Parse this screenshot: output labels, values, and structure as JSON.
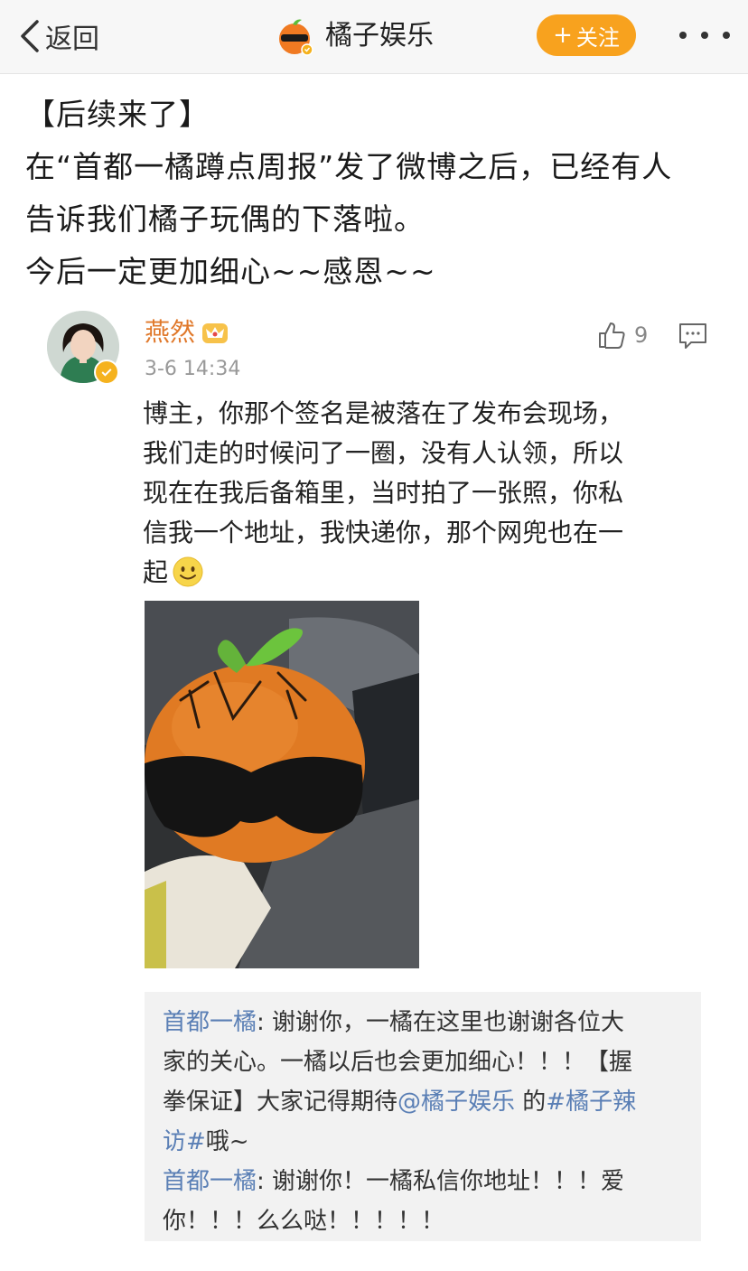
{
  "nav": {
    "back_label": "返回",
    "title": "橘子娱乐",
    "follow_plus": "+",
    "follow_label": "关注",
    "avatar_icon": "sunglasses-orange-logo-icon",
    "more_icon": "more-dots-icon",
    "accent": "#f8a21e"
  },
  "post": {
    "lines": [
      "【后续来了】",
      "在“首都一橘蹲点周报”发了微博之后，已经有人",
      "告诉我们橘子玩偶的下落啦。",
      "今后一定更加细心~~感恩~~"
    ]
  },
  "comment": {
    "user": "燕然",
    "time": "3-6 14:34",
    "likes": "9",
    "text_lines": [
      "博主，你那个签名是被落在了发布会现场，",
      "我们走的时候问了一圈，没有人认领，所以",
      "现在在我后备箱里，当时拍了一张照，你私",
      "信我一个地址，我快递你，那个网兜也在一",
      "起"
    ],
    "name_color": "#e0782a"
  },
  "replies": {
    "r1_user": "首都一橘",
    "r1_l1": ": 谢谢你，一橘在这里也谢谢各位大",
    "r1_l2": "家的关心。一橘以后也会更加细心！！！【握",
    "r1_l3": "拳保证】大家记得期待",
    "r1_mention": "@橘子娱乐",
    "r1_de": " 的",
    "r1_tag_a": "#橘子辣",
    "r1_tag_b": "访#",
    "r1_end": "哦~",
    "r2_user": "首都一橘",
    "r2_l1": ": 谢谢你！一橘私信你地址！！！爱",
    "r2_l2": "你！！！么么哒！！！！！",
    "link_color": "#5a7fb5"
  }
}
